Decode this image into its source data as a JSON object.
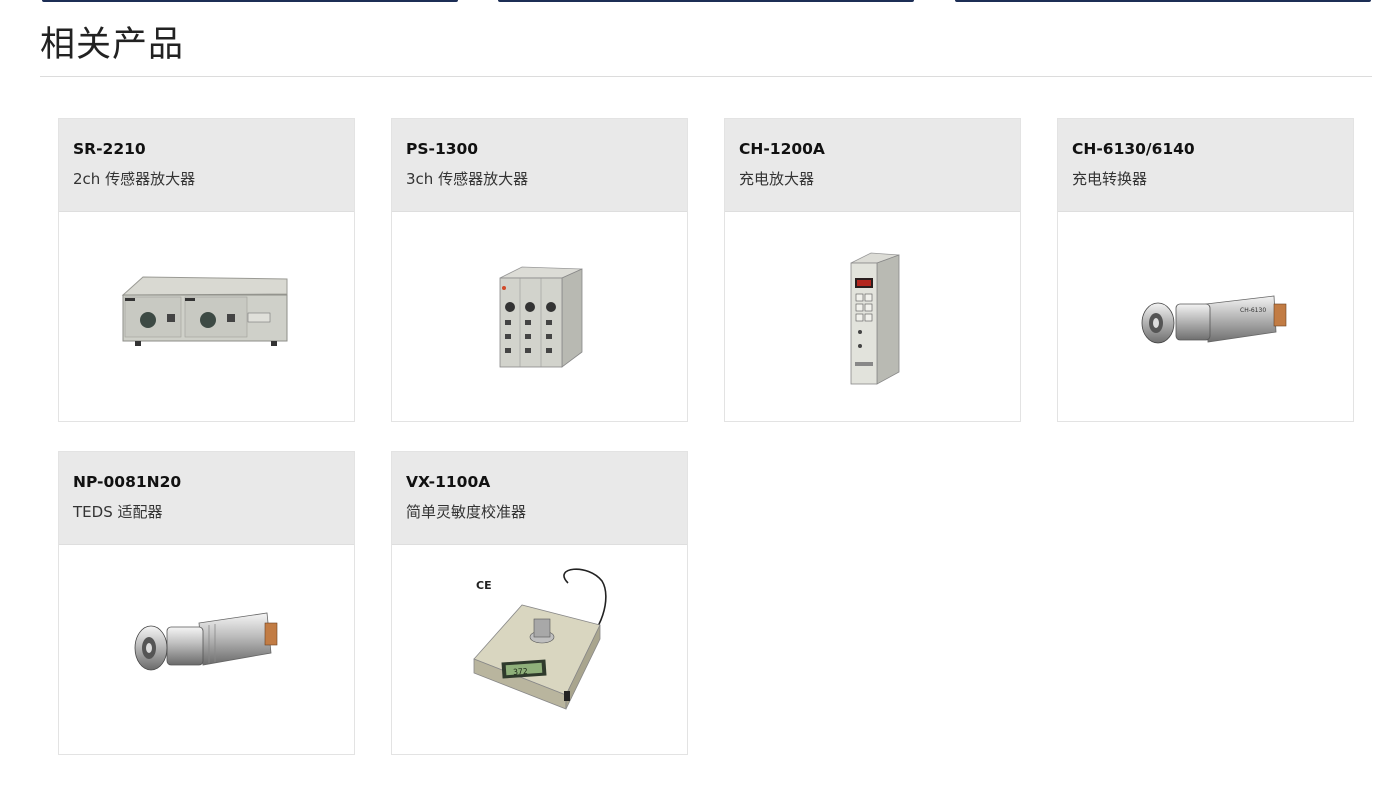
{
  "section": {
    "title": "相关产品"
  },
  "products": [
    {
      "model": "SR-2210",
      "desc": "2ch 传感器放大器",
      "image": "sensor-amplifier-2ch-image"
    },
    {
      "model": "PS-1300",
      "desc": "3ch 传感器放大器",
      "image": "sensor-amplifier-3ch-image"
    },
    {
      "model": "CH-1200A",
      "desc": "充电放大器",
      "image": "charge-amplifier-image"
    },
    {
      "model": "CH-6130/6140",
      "desc": "充电转换器",
      "image": "charge-converter-image"
    },
    {
      "model": "NP-0081N20",
      "desc": "TEDS 适配器",
      "image": "teds-adapter-image"
    },
    {
      "model": "VX-1100A",
      "desc": "简单灵敏度校准器",
      "image": "sensitivity-calibrator-image"
    }
  ],
  "calibrator": {
    "display_value": "372",
    "ce_mark": "CE"
  },
  "colors": {
    "tab_bar": "#1c2e55",
    "card_header": "#e9e9e9",
    "divider": "#dcdcdc"
  }
}
